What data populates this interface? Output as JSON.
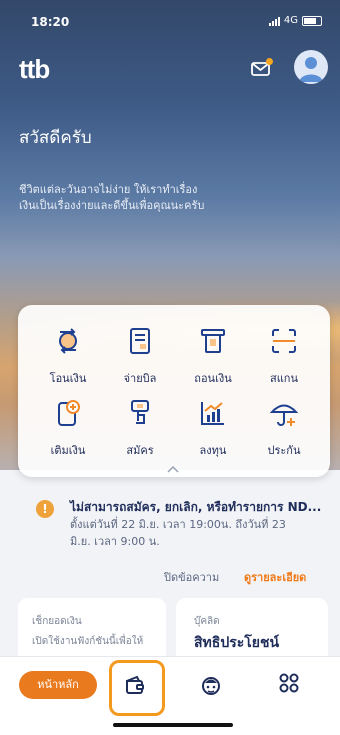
{
  "status_bar": {
    "time": "18:20",
    "network": "4G"
  },
  "header": {
    "logo": "ttb"
  },
  "hero": {
    "greeting": "สวัสดีครับ",
    "subtitle_line1": "ชีวิตแต่ละวันอาจไม่ง่าย ให้เราทำเรื่อง",
    "subtitle_line2": "เงินเป็นเรื่องง่ายและดีขึ้นเพื่อคุณนะครับ"
  },
  "quick_actions": [
    {
      "label": "โอนเงิน",
      "icon": "transfer-icon"
    },
    {
      "label": "จ่ายบิล",
      "icon": "bill-icon"
    },
    {
      "label": "ถอนเงิน",
      "icon": "withdraw-icon"
    },
    {
      "label": "สแกน",
      "icon": "scan-icon"
    },
    {
      "label": "เติมเงิน",
      "icon": "topup-icon"
    },
    {
      "label": "สมัคร",
      "icon": "apply-icon"
    },
    {
      "label": "ลงทุน",
      "icon": "invest-icon"
    },
    {
      "label": "ประกัน",
      "icon": "insurance-icon"
    }
  ],
  "notice": {
    "title": "ไม่สามารถสมัคร, ยกเลิก, หรือทำรายการ ND...",
    "text_line1": "ตั้งแต่วันที่ 22 มิ.ย. เวลา 19:00น. ถึงวันที่ 23",
    "text_line2": "มิ.ย. เวลา 9:00 น.",
    "close_label": "ปิดข้อความ",
    "details_label": "ดูรายละเอียด"
  },
  "cards": {
    "balance": {
      "title": "เช็กยอดเงิน",
      "text": "เปิดใช้งานฟังก์ชันนี้เพื่อให้"
    },
    "privilege": {
      "title": "บุ๊คลิด",
      "text": "สิทธิประโยชน์"
    }
  },
  "bottom_nav": {
    "home_label": "หน้าหลัก"
  },
  "colors": {
    "accent": "#ea7a1e",
    "navy": "#1f2d5a",
    "highlight": "#f39a1e"
  }
}
